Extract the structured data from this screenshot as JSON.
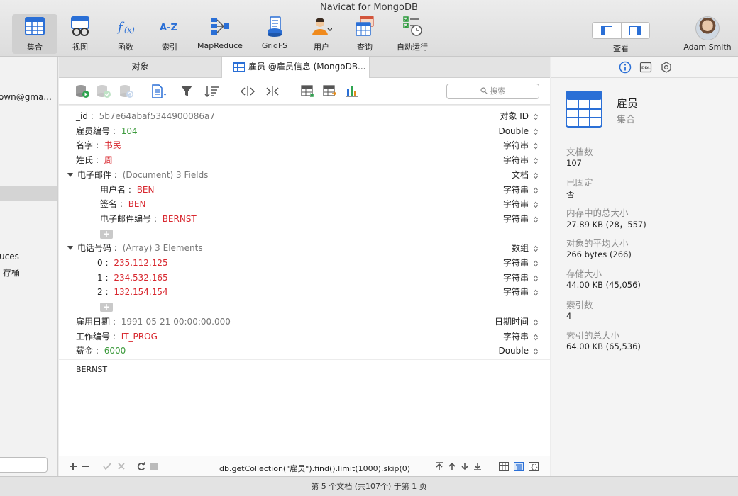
{
  "window": {
    "title": "Navicat for MongoDB"
  },
  "toolbar": {
    "items": [
      {
        "label": "集合",
        "icon": "collection-icon"
      },
      {
        "label": "视图",
        "icon": "view-icon"
      },
      {
        "label": "函数",
        "icon": "function-icon"
      },
      {
        "label": "索引",
        "icon": "index-icon"
      },
      {
        "label": "MapReduce",
        "icon": "mapreduce-icon"
      },
      {
        "label": "GridFS",
        "icon": "gridfs-icon"
      },
      {
        "label": "用户",
        "icon": "user-icon"
      },
      {
        "label": "查询",
        "icon": "query-icon"
      },
      {
        "label": "自动运行",
        "icon": "automation-icon"
      }
    ],
    "view_label": "查看",
    "user_name": "Adam Smith"
  },
  "sidebar": {
    "connection_text": "own@gma...",
    "item_reduces": "uces",
    "item_bucket": "存桶"
  },
  "tabs": {
    "objects": "对象",
    "document": "雇员 @雇员信息 (MongoDB..."
  },
  "search": {
    "placeholder": "搜索"
  },
  "document": {
    "rows": [
      {
        "key": "_id",
        "sep": " : ",
        "value": "5b7e64abaf5344900086a7",
        "type": "对象 ID",
        "color": "gray",
        "indent": 0
      },
      {
        "key": "雇员编号",
        "sep": " : ",
        "value": "104",
        "type": "Double",
        "color": "green",
        "indent": 0
      },
      {
        "key": "名字",
        "sep": " : ",
        "value": "书民",
        "type": "字符串",
        "color": "red",
        "indent": 0
      },
      {
        "key": "姓氏",
        "sep": " : ",
        "value": "周",
        "type": "字符串",
        "color": "red",
        "indent": 0
      },
      {
        "key": "电子邮件",
        "sep": " : ",
        "value": "(Document) 3 Fields",
        "type": "文档",
        "color": "gray",
        "indent": 0,
        "expand": true
      },
      {
        "key": "用户名",
        "sep": " : ",
        "value": "BEN",
        "type": "字符串",
        "color": "red",
        "indent": 1
      },
      {
        "key": "签名",
        "sep": " : ",
        "value": "BEN",
        "type": "字符串",
        "color": "red",
        "indent": 1
      },
      {
        "key": "电子邮件编号",
        "sep": " : ",
        "value": "BERNST",
        "type": "字符串",
        "color": "red",
        "indent": 1
      },
      {
        "add": true,
        "indent": 1
      },
      {
        "key": "电话号码",
        "sep": " : ",
        "value": "(Array) 3 Elements",
        "type": "数组",
        "color": "gray",
        "indent": 0,
        "expand": true
      },
      {
        "key": "0",
        "sep": " : ",
        "value": "235.112.125",
        "type": "字符串",
        "color": "red",
        "indent": 2
      },
      {
        "key": "1",
        "sep": " : ",
        "value": "234.532.165",
        "type": "字符串",
        "color": "red",
        "indent": 2
      },
      {
        "key": "2",
        "sep": " : ",
        "value": "132.154.154",
        "type": "字符串",
        "color": "red",
        "indent": 2
      },
      {
        "add": true,
        "indent": 1
      },
      {
        "key": "雇用日期",
        "sep": " : ",
        "value": "1991-05-21 00:00:00.000",
        "type": "日期时间",
        "color": "gray",
        "indent": 0
      },
      {
        "key": "工作编号",
        "sep": " : ",
        "value": "IT_PROG",
        "type": "字符串",
        "color": "red",
        "indent": 0
      },
      {
        "key": "薪金",
        "sep": " : ",
        "value": "6000",
        "type": "Double",
        "color": "green",
        "indent": 0
      }
    ]
  },
  "editor": {
    "text": "BERNST"
  },
  "bottom": {
    "query": "db.getCollection(\"雇员\").find().limit(1000).skip(0)"
  },
  "info": {
    "name": "雇员",
    "type": "集合",
    "fields": [
      {
        "label": "文档数",
        "value": "107"
      },
      {
        "label": "已固定",
        "value": "否"
      },
      {
        "label": "内存中的总大小",
        "value": "27.89 KB (28，557)"
      },
      {
        "label": "对象的平均大小",
        "value": "266 bytes (266)"
      },
      {
        "label": "存储大小",
        "value": "44.00 KB (45,056)"
      },
      {
        "label": "索引数",
        "value": "4"
      },
      {
        "label": "索引的总大小",
        "value": "64.00 KB (65,536)"
      }
    ]
  },
  "status": {
    "text": "第 5 个文档 (共107个) 于第 1 页"
  },
  "colors": {
    "green": "#3c9a3c",
    "red": "#d8282f",
    "gray": "#777777",
    "accent": "#2a6fd6"
  }
}
